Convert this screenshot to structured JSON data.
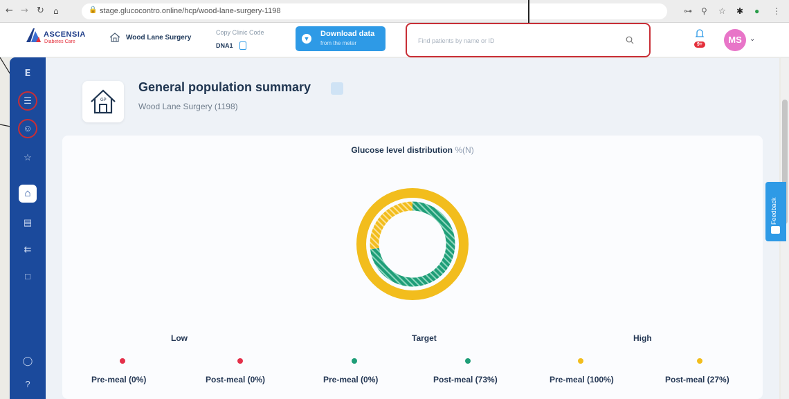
{
  "browser": {
    "url": "stage.glucocontro.online/hcp/wood-lane-surgery-1198"
  },
  "header": {
    "brand": "ASCENSIA",
    "brand_sub": "Diabetes Care",
    "clinic_name": "Wood Lane Surgery",
    "code_label": "Copy Clinic Code",
    "code_value": "DNA1",
    "download_title": "Download data",
    "download_sub": "from the meter",
    "search_placeholder": "Find patients by name or ID",
    "notification_badge": "9+",
    "avatar_initials": "MS"
  },
  "page": {
    "title": "General population summary",
    "subtitle": "Wood Lane Surgery (1198)",
    "feedback_label": "Feedback"
  },
  "colors": {
    "sidebar": "#1b4a9c",
    "accent": "#2e9ae6",
    "low": "#e4304a",
    "target": "#1f9e78",
    "high": "#f2bd1d",
    "callout": "#c82e36"
  },
  "chart_data": {
    "type": "donut",
    "title": "Glucose level distribution",
    "title_unit": "%(N)",
    "rings": [
      {
        "segments": [
          {
            "category": "Low",
            "value": 0
          },
          {
            "category": "Target",
            "value": 0
          },
          {
            "category": "High",
            "value": 100
          }
        ]
      },
      {
        "segments": [
          {
            "category": "Low",
            "value": 0
          },
          {
            "category": "Target",
            "value": 73
          },
          {
            "category": "High",
            "value": 27
          }
        ]
      }
    ],
    "groups": [
      {
        "label": "Low",
        "items": [
          {
            "label": "Pre-meal (0%)",
            "color": "#e4304a"
          },
          {
            "label": "Post-meal (0%)",
            "color": "#e4304a"
          }
        ]
      },
      {
        "label": "Target",
        "items": [
          {
            "label": "Pre-meal (0%)",
            "color": "#1f9e78"
          },
          {
            "label": "Post-meal (73%)",
            "color": "#1f9e78"
          }
        ]
      },
      {
        "label": "High",
        "items": [
          {
            "label": "Pre-meal (100%)",
            "color": "#f2bd1d"
          },
          {
            "label": "Post-meal (27%)",
            "color": "#f2bd1d"
          }
        ]
      }
    ]
  }
}
